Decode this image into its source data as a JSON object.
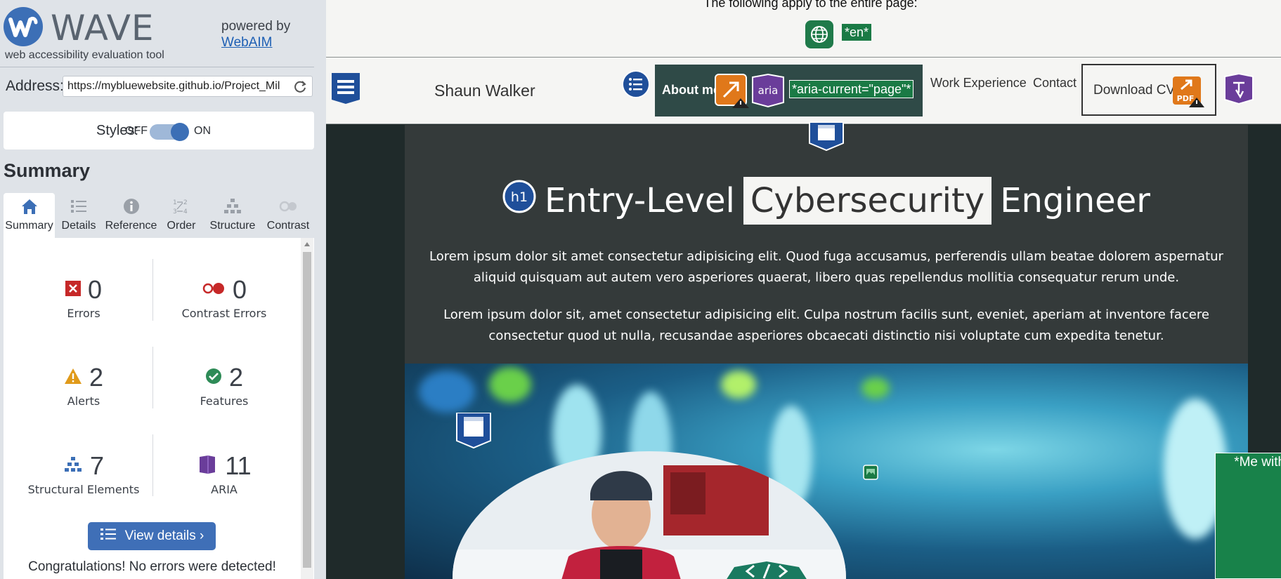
{
  "wave": {
    "title": "WAVE",
    "tagline": "web accessibility evaluation tool",
    "powered_by": "powered by",
    "webaim": "WebAIM",
    "address_label": "Address:",
    "address_value": "https://mybluewebsite.github.io/Project_Mil",
    "styles_label": "Styles:",
    "styles_off": "OFF",
    "styles_on": "ON",
    "styles_enabled": true,
    "summary_heading": "Summary",
    "tabs": [
      {
        "label": "Summary",
        "icon": "home-icon",
        "active": true
      },
      {
        "label": "Details",
        "icon": "list-icon",
        "active": false
      },
      {
        "label": "Reference",
        "icon": "info-icon",
        "active": false
      },
      {
        "label": "Order",
        "icon": "order-icon",
        "active": false
      },
      {
        "label": "Structure",
        "icon": "structure-icon",
        "active": false
      },
      {
        "label": "Contrast",
        "icon": "contrast-icon",
        "active": false
      }
    ],
    "stats": {
      "errors": {
        "value": "0",
        "label": "Errors",
        "color": "#c62828"
      },
      "contrast_errors": {
        "value": "0",
        "label": "Contrast Errors",
        "color": "#c62828"
      },
      "alerts": {
        "value": "2",
        "label": "Alerts",
        "color": "#e09a1a"
      },
      "features": {
        "value": "2",
        "label": "Features",
        "color": "#2e8b57"
      },
      "structural": {
        "value": "7",
        "label": "Structural Elements",
        "color": "#3c6fb6"
      },
      "aria": {
        "value": "11",
        "label": "ARIA",
        "color": "#6a3d9a"
      }
    },
    "view_details": "View details ›",
    "congrats": "Congratulations! No errors were detected!"
  },
  "page": {
    "applies_text": "The following apply to the entire page:",
    "lang_badge": "*en*",
    "site_name": "Shaun Walker",
    "nav": {
      "about": "About me",
      "aria_label": "aria",
      "aria_current": "*aria-current=\"page\"*",
      "work": "Work Experience",
      "contact": "Contact",
      "download": "Download CV",
      "pdf": "PDF"
    },
    "h1_badge": "h1",
    "title_before": "Entry-Level",
    "title_highlight": "Cybersecurity",
    "title_after": "Engineer",
    "para1": "Lorem ipsum dolor sit amet consectetur adipisicing elit. Quod fuga accusamus, perferendis ullam beatae dolorem aspernatur aliquid quisquam aut autem vero asperiores quaerat, libero quas repellendus mollitia consequatur rerum unde.",
    "para2": "Lorem ipsum dolor sit, amet consectetur adipisicing elit. Culpa nostrum facilis sunt, eveniet, aperiam at inventore facere consectetur quod ut nulla, recusandae asperiores obcaecati distinctio nisi voluptate cum expedita tenetur.",
    "alt_text": "*Me with several dogs in the snow*"
  },
  "colors": {
    "wave_blue": "#3c6fb6",
    "feature_green": "#1a7a45",
    "aria_purple": "#6a3d9a",
    "alert_orange": "#e0781a",
    "hero_bg": "#343a3a"
  }
}
